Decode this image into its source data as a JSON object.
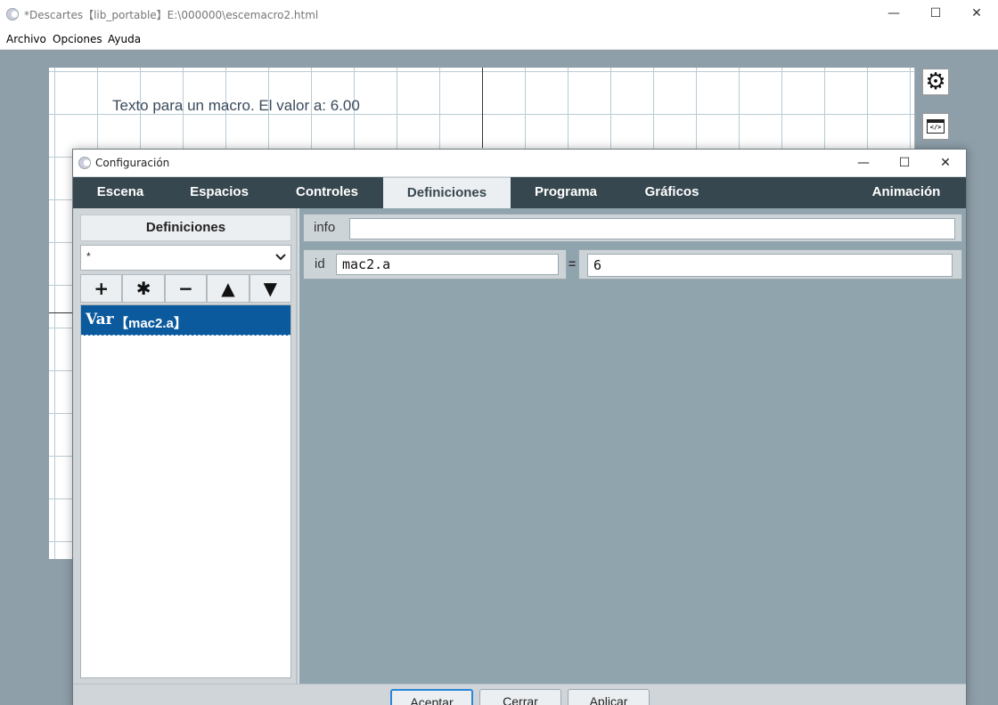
{
  "window": {
    "title": "*Descartes【lib_portable】E:\\000000\\escemacro2.html",
    "minimize": "—",
    "maximize": "☐",
    "close": "✕"
  },
  "menu": {
    "items": [
      "Archivo",
      "Opciones",
      "Ayuda"
    ]
  },
  "scene": {
    "text": "Texto para un macro. El valor a: 6.00"
  },
  "dialog": {
    "title": "Configuración",
    "minimize": "—",
    "maximize": "☐",
    "close": "✕",
    "tabs": [
      "Escena",
      "Espacios",
      "Controles",
      "Definiciones",
      "Programa",
      "Gráficos",
      "Animación"
    ],
    "active_tab": "Definiciones",
    "left": {
      "header": "Definiciones",
      "filter_value": "*",
      "buttons": [
        "+",
        "✱",
        "−",
        "▲",
        "▼"
      ],
      "items": [
        {
          "type": "Var",
          "name": "【mac2.a】"
        }
      ]
    },
    "info": {
      "label": "info",
      "value": ""
    },
    "id_row": {
      "label": "id",
      "id_value": "mac2.a",
      "equals": "=",
      "expr_value": "6"
    },
    "footer": {
      "accept": "Aceptar",
      "close": "Cerrar",
      "apply": "Aplicar"
    }
  },
  "colors": {
    "tabbar": "#37474f",
    "selected_item": "#0b5a9e",
    "panel": "#90a4ae"
  }
}
